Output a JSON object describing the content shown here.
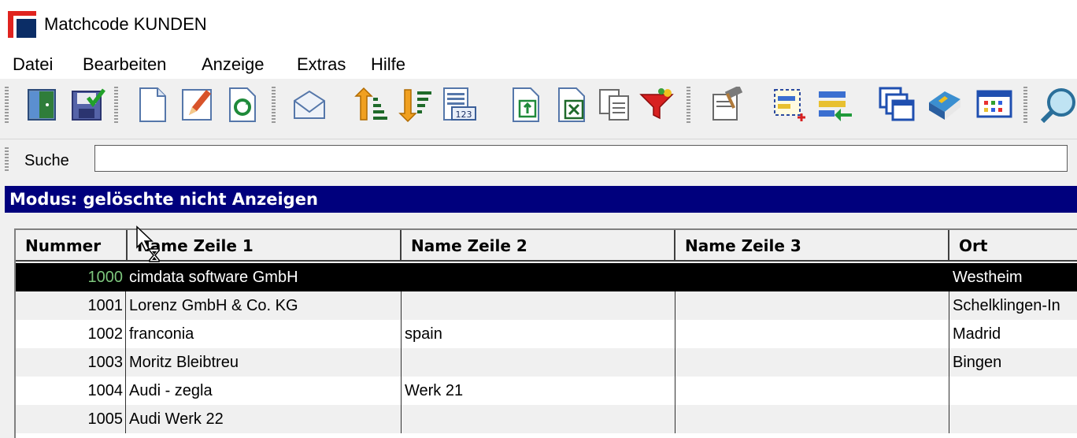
{
  "window": {
    "title": "Matchcode KUNDEN"
  },
  "menu": [
    "Datei",
    "Bearbeiten",
    "Anzeige",
    "Extras",
    "Hilfe"
  ],
  "toolbar": {
    "buttons": [
      "exit-door-icon",
      "save-icon",
      "new-document-icon",
      "edit-pencil-icon",
      "refresh-document-icon",
      "mail-envelope-icon",
      "sort-ascending-icon",
      "sort-descending-icon",
      "numeric-list-icon",
      "export-document-icon",
      "excel-export-icon",
      "copy-documents-icon",
      "filter-funnel-icon",
      "hammer-document-icon",
      "select-area-icon",
      "transfer-list-icon",
      "windows-icon",
      "book-icon",
      "table-grid-icon",
      "search-magnifier-icon"
    ]
  },
  "search": {
    "label": "Suche",
    "value": ""
  },
  "mode": {
    "text": "Modus: gelöschte nicht Anzeigen"
  },
  "table": {
    "columns": [
      "Nummer",
      "Name Zeile 1",
      "Name Zeile 2",
      "Name Zeile 3",
      "Ort"
    ],
    "rows": [
      {
        "nummer": "1000",
        "name1": "cimdata software GmbH",
        "name2": "",
        "name3": "",
        "ort": "Westheim",
        "selected": true
      },
      {
        "nummer": "1001",
        "name1": "Lorenz GmbH & Co. KG",
        "name2": "",
        "name3": "",
        "ort": "Schelklingen-In"
      },
      {
        "nummer": "1002",
        "name1": "franconia",
        "name2": "spain",
        "name3": "",
        "ort": "Madrid"
      },
      {
        "nummer": "1003",
        "name1": "Moritz Bleibtreu",
        "name2": "",
        "name3": "",
        "ort": "Bingen"
      },
      {
        "nummer": "1004",
        "name1": "Audi - zegla",
        "name2": "Werk 21",
        "name3": "",
        "ort": ""
      },
      {
        "nummer": "1005",
        "name1": "Audi Werk 22",
        "name2": "",
        "name3": "",
        "ort": ""
      }
    ]
  },
  "colors": {
    "mode_banner": "#00007d",
    "selected_row": "#000000",
    "selected_number": "#7dc67d",
    "alt_row": "#f0f0f0"
  }
}
